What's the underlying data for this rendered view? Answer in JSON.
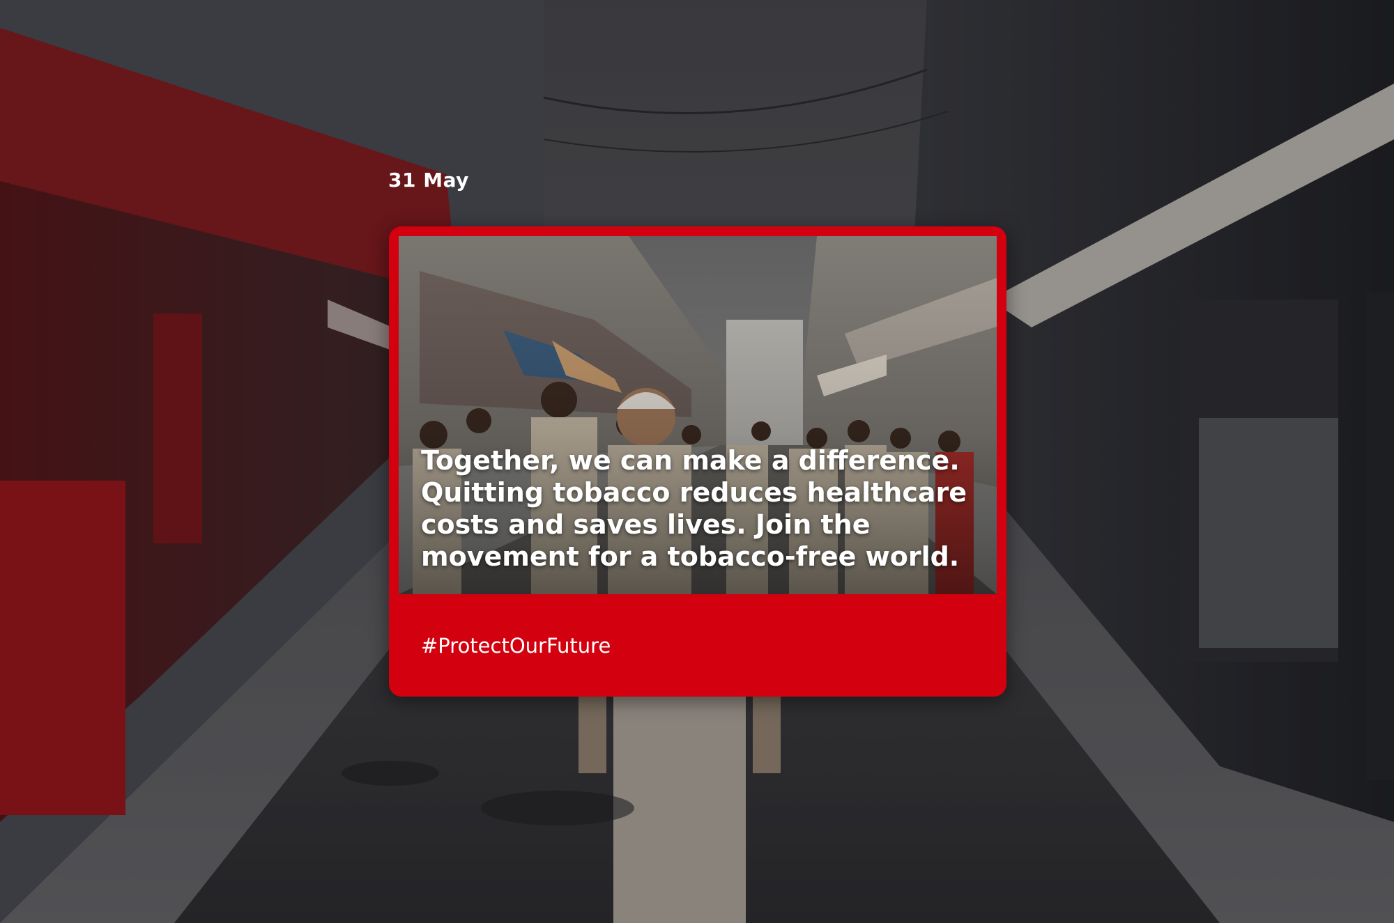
{
  "post": {
    "date": "31 May",
    "message": "Together, we can make a difference. Quitting tobacco reduces healthcare costs and saves lives. Join the movement for a tobacco-free world.",
    "hashtag": "#ProtectOurFuture"
  },
  "colors": {
    "card_red": "#d3000f",
    "text_white": "#ffffff"
  }
}
